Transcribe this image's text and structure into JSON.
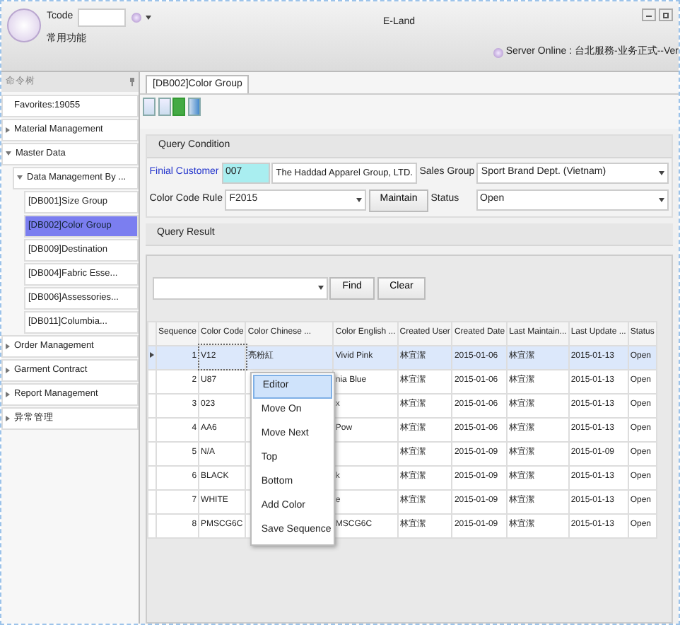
{
  "window": {
    "title": "E-Land",
    "tcode_label": "Tcode",
    "favorites_menu": "常用功能",
    "server_status": "Server Online : 台北服務-业务正式--Ver"
  },
  "sidebar": {
    "title": "命令树",
    "items": [
      {
        "label": "Favorites:19055"
      },
      {
        "label": "Material Management",
        "expanded": false
      },
      {
        "label": "Master Data",
        "expanded": true,
        "children": [
          {
            "label": "Data Management By ...",
            "expanded": true,
            "children": [
              {
                "label": "[DB001]Size Group",
                "selected": false
              },
              {
                "label": "[DB002]Color Group",
                "selected": true
              },
              {
                "label": "[DB009]Destination",
                "selected": false
              },
              {
                "label": "[DB004]Fabric Esse...",
                "selected": false
              },
              {
                "label": "[DB006]Assessories...",
                "selected": false
              },
              {
                "label": "[DB011]Columbia...",
                "selected": false
              }
            ]
          }
        ]
      },
      {
        "label": "Order Management",
        "expanded": false
      },
      {
        "label": "Garment Contract",
        "expanded": false
      },
      {
        "label": "Report Management",
        "expanded": false
      },
      {
        "label": "异常管理",
        "expanded": false
      }
    ]
  },
  "tabs": [
    {
      "label": "[DB002]Color Group",
      "selected": true
    }
  ],
  "query_condition": {
    "title": "Query Condition",
    "final_customer_label": "Finial Customer",
    "final_customer_code": "007",
    "final_customer_name": "The Haddad Apparel Group, LTD.",
    "sales_group_label": "Sales Group",
    "sales_group": "Sport Brand Dept. (Vietnam)",
    "color_code_rule_label": "Color Code Rule",
    "color_code_rule": "F2015",
    "maintain_button": "Maintain",
    "status_label": "Status",
    "status": "Open"
  },
  "query_result": {
    "title": "Query Result",
    "find_button": "Find",
    "clear_button": "Clear",
    "columns": [
      "Sequence",
      "Color Code",
      "Color Chinese ...",
      "Color English ...",
      "Created User",
      "Created Date",
      "Last Maintain...",
      "Last Update ...",
      "Status"
    ],
    "rows": [
      {
        "sequence": "1",
        "color_code": "V12",
        "color_chinese": "亮粉紅",
        "color_english": "Vivid Pink",
        "created_user": "林宜潔",
        "created_date": "2015-01-06",
        "last_maintain": "林宜潔",
        "last_update": "2015-01-13",
        "status": "Open",
        "selected": true
      },
      {
        "sequence": "2",
        "color_code": "U87",
        "color_english": "nia Blue",
        "created_user": "林宜潔",
        "created_date": "2015-01-06",
        "last_maintain": "林宜潔",
        "last_update": "2015-01-13",
        "status": "Open",
        "selected": false
      },
      {
        "sequence": "3",
        "color_code": "023",
        "color_english": "x",
        "created_user": "林宜潔",
        "created_date": "2015-01-06",
        "last_maintain": "林宜潔",
        "last_update": "2015-01-13",
        "status": "Open",
        "selected": false
      },
      {
        "sequence": "4",
        "color_code": "AA6",
        "color_english": "Pow",
        "created_user": "林宜潔",
        "created_date": "2015-01-06",
        "last_maintain": "林宜潔",
        "last_update": "2015-01-13",
        "status": "Open",
        "selected": false
      },
      {
        "sequence": "5",
        "color_code": "N/A",
        "created_user": "林宜潔",
        "created_date": "2015-01-09",
        "last_maintain": "林宜潔",
        "last_update": "2015-01-09",
        "status": "Open",
        "selected": false
      },
      {
        "sequence": "6",
        "color_code": "BLACK",
        "color_english": "k",
        "created_user": "林宜潔",
        "created_date": "2015-01-09",
        "last_maintain": "林宜潔",
        "last_update": "2015-01-13",
        "status": "Open",
        "selected": false
      },
      {
        "sequence": "7",
        "color_code": "WHITE",
        "color_english": "e",
        "created_user": "林宜潔",
        "created_date": "2015-01-09",
        "last_maintain": "林宜潔",
        "last_update": "2015-01-13",
        "status": "Open",
        "selected": false
      },
      {
        "sequence": "8",
        "color_code": "PMSCG6C",
        "color_english": "MSCG6C",
        "created_user": "林宜潔",
        "created_date": "2015-01-09",
        "last_maintain": "林宜潔",
        "last_update": "2015-01-13",
        "status": "Open",
        "selected": false
      }
    ],
    "context_menu": [
      {
        "label": "Editor",
        "selected": true
      },
      {
        "label": "Move On",
        "selected": false
      },
      {
        "label": "Move Next",
        "selected": false
      },
      {
        "label": "Top",
        "selected": false
      },
      {
        "label": "Bottom",
        "selected": false
      },
      {
        "label": "Add Color",
        "selected": false
      },
      {
        "label": "Save Sequence",
        "selected": false
      }
    ]
  }
}
